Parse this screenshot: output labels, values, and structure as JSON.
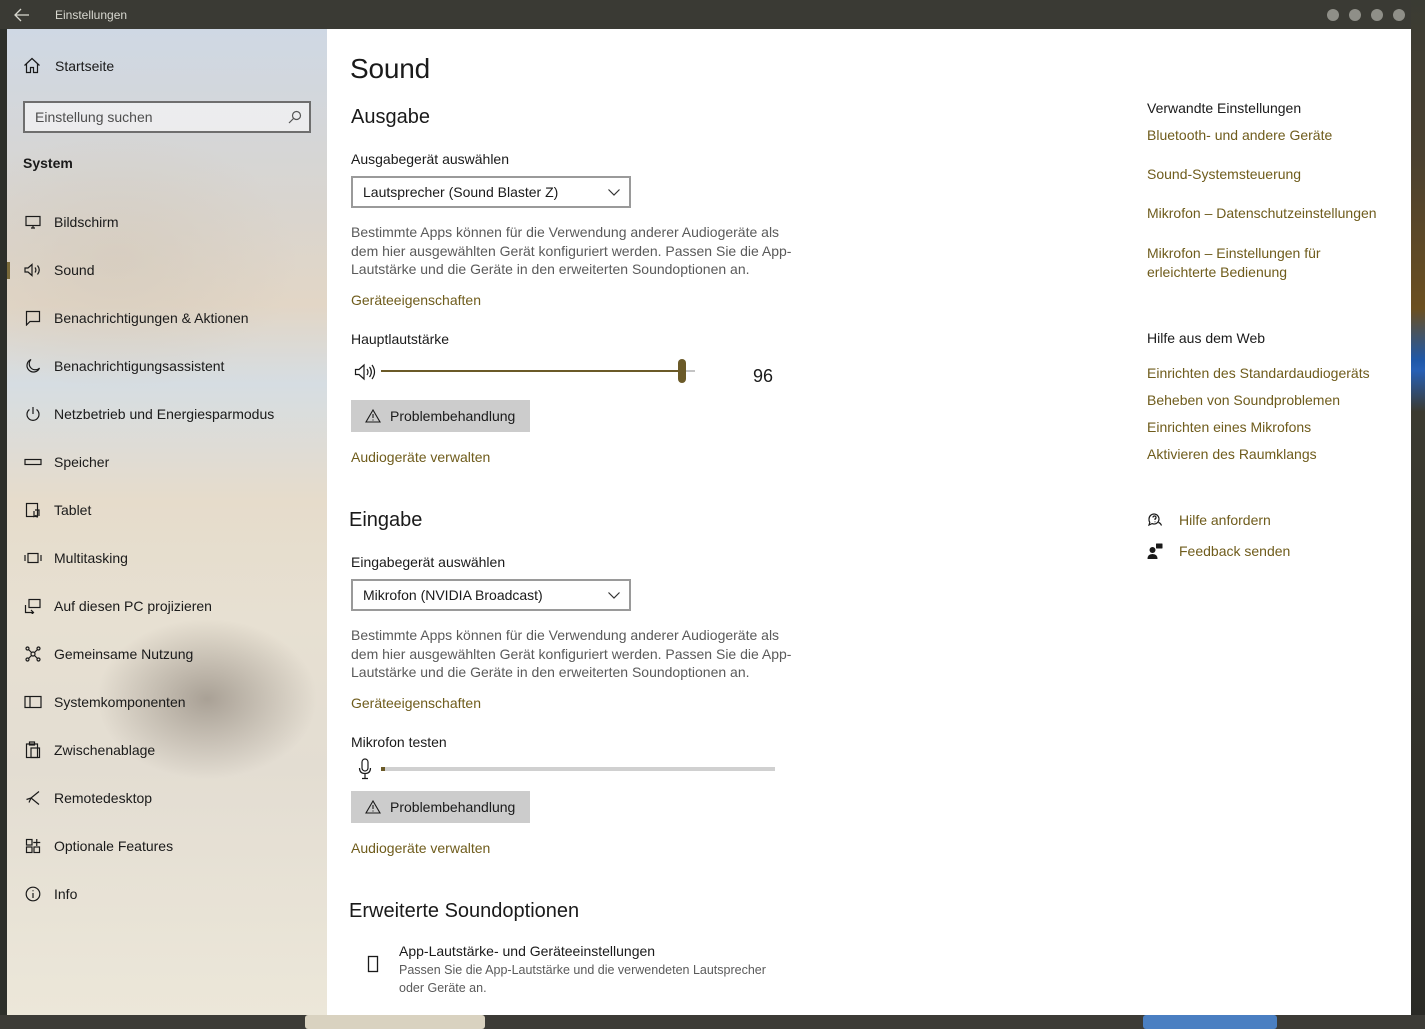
{
  "window": {
    "title": "Einstellungen"
  },
  "sidebar": {
    "home_label": "Startseite",
    "search_placeholder": "Einstellung suchen",
    "section_title": "System",
    "items": [
      {
        "label": "Bildschirm",
        "icon": "monitor-icon"
      },
      {
        "label": "Sound",
        "icon": "speaker-icon",
        "active": true
      },
      {
        "label": "Benachrichtigungen & Aktionen",
        "icon": "notification-icon"
      },
      {
        "label": "Benachrichtigungsassistent",
        "icon": "moon-icon"
      },
      {
        "label": "Netzbetrieb und Energiesparmodus",
        "icon": "power-icon"
      },
      {
        "label": "Speicher",
        "icon": "storage-icon"
      },
      {
        "label": "Tablet",
        "icon": "tablet-icon"
      },
      {
        "label": "Multitasking",
        "icon": "multitasking-icon"
      },
      {
        "label": "Auf diesen PC projizieren",
        "icon": "project-icon"
      },
      {
        "label": "Gemeinsame Nutzung",
        "icon": "share-icon"
      },
      {
        "label": "Systemkomponenten",
        "icon": "components-icon"
      },
      {
        "label": "Zwischenablage",
        "icon": "clipboard-icon"
      },
      {
        "label": "Remotedesktop",
        "icon": "remote-icon"
      },
      {
        "label": "Optionale Features",
        "icon": "features-icon"
      },
      {
        "label": "Info",
        "icon": "info-icon"
      }
    ]
  },
  "main": {
    "title": "Sound",
    "output": {
      "heading": "Ausgabe",
      "device_label": "Ausgabegerät auswählen",
      "device_value": "Lautsprecher (Sound Blaster Z)",
      "description": "Bestimmte Apps können für die Verwendung anderer Audiogeräte als dem hier ausgewählten Gerät konfiguriert werden. Passen Sie die App-Lautstärke und die Geräte in den erweiterten Soundoptionen an.",
      "properties_link": "Geräteeigenschaften",
      "volume_label": "Hauptlautstärke",
      "volume_value": "96",
      "troubleshoot_label": "Problembehandlung",
      "manage_link": "Audiogeräte verwalten"
    },
    "input": {
      "heading": "Eingabe",
      "device_label": "Eingabegerät auswählen",
      "device_value": "Mikrofon (NVIDIA Broadcast)",
      "description": "Bestimmte Apps können für die Verwendung anderer Audiogeräte als dem hier ausgewählten Gerät konfiguriert werden. Passen Sie die App-Lautstärke und die Geräte in den erweiterten Soundoptionen an.",
      "properties_link": "Geräteeigenschaften",
      "test_label": "Mikrofon testen",
      "mic_level": 0.01,
      "troubleshoot_label": "Problembehandlung",
      "manage_link": "Audiogeräte verwalten"
    },
    "advanced": {
      "heading": "Erweiterte Soundoptionen",
      "item_title": "App-Lautstärke- und Geräteeinstellungen",
      "item_desc": "Passen Sie die App-Lautstärke und die verwendeten Lautsprecher oder Geräte an."
    }
  },
  "related": {
    "heading": "Verwandte Einstellungen",
    "links": [
      "Bluetooth- und andere Geräte",
      "Sound-Systemsteuerung",
      "Mikrofon – Datenschutzeinstellungen",
      "Mikrofon – Einstellungen für erleichterte Bedienung"
    ]
  },
  "web_help": {
    "heading": "Hilfe aus dem Web",
    "links": [
      "Einrichten des Standardaudiogeräts",
      "Beheben von Soundproblemen",
      "Einrichten eines Mikrofons",
      "Aktivieren des Raumklangs"
    ]
  },
  "support": {
    "get_help": "Hilfe anfordern",
    "feedback": "Feedback senden"
  },
  "colors": {
    "accent": "#6f5c1c",
    "slider": "#6b5a28"
  }
}
